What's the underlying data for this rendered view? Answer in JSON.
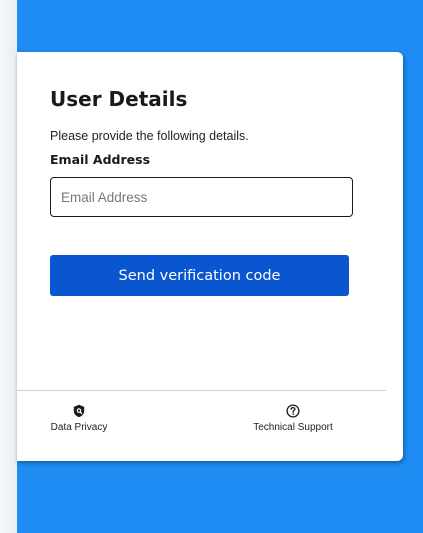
{
  "form": {
    "title": "User Details",
    "description": "Please provide the following details.",
    "email_label": "Email Address",
    "email_placeholder": "Email Address",
    "email_value": "",
    "submit_label": "Send verification code"
  },
  "footer": {
    "privacy_label": "Data Privacy",
    "privacy_icon": "shield-lock-icon",
    "support_label": "Technical Support",
    "support_icon": "help-circle-icon"
  },
  "colors": {
    "background": "#1e8cf2",
    "primary_button": "#0a56d1",
    "card": "#ffffff"
  }
}
